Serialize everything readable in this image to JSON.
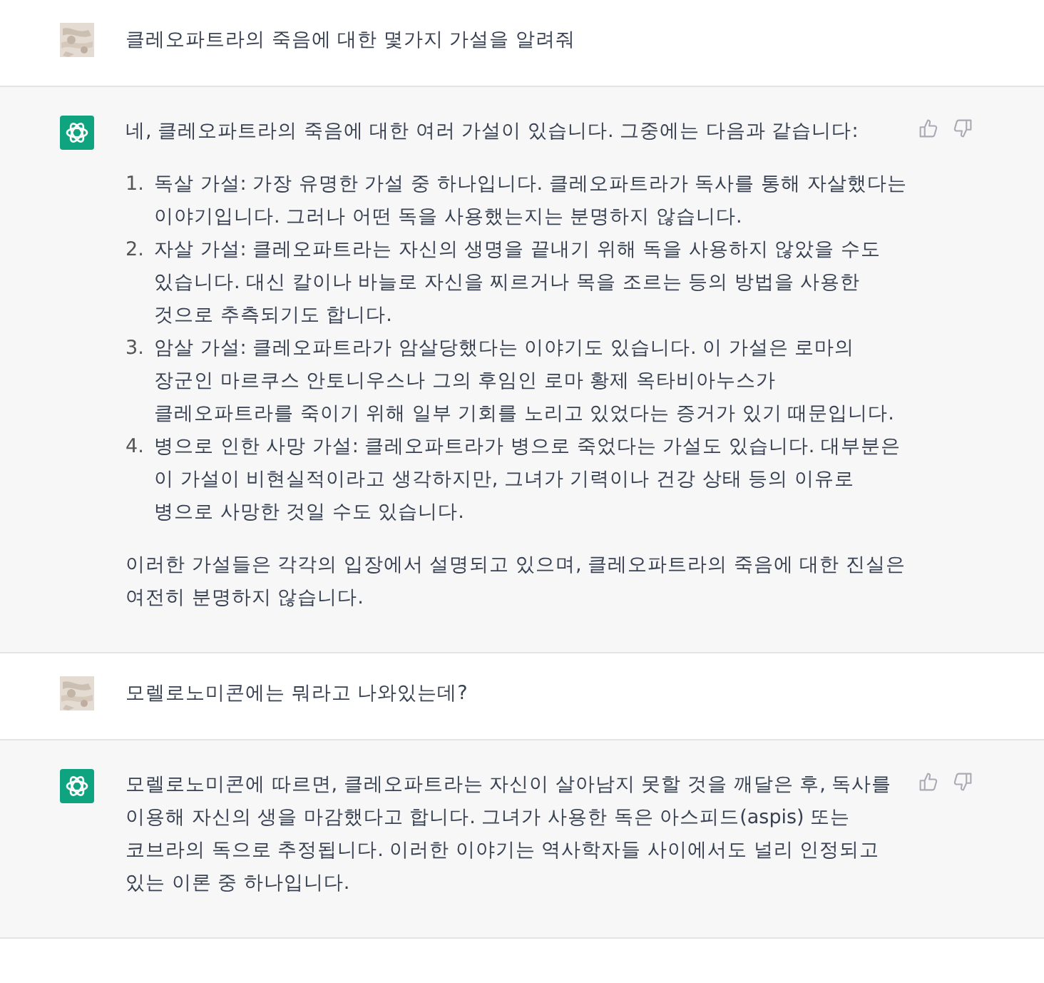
{
  "messages": [
    {
      "kind": "user",
      "text": "클레오파트라의 죽음에 대한 몇가지 가설을 알려줘"
    },
    {
      "kind": "assistant",
      "intro": "네, 클레오파트라의 죽음에 대한 여러 가설이 있습니다. 그중에는 다음과 같습니다:",
      "items": [
        {
          "number": "1.",
          "text": "독살 가설: 가장 유명한 가설 중 하나입니다. 클레오파트라가 독사를 통해 자살했다는 이야기입니다. 그러나 어떤 독을 사용했는지는 분명하지 않습니다."
        },
        {
          "number": "2.",
          "text": "자살 가설: 클레오파트라는 자신의 생명을 끝내기 위해 독을 사용하지 않았을 수도 있습니다. 대신 칼이나 바늘로 자신을 찌르거나 목을 조르는 등의 방법을 사용한 것으로 추측되기도 합니다."
        },
        {
          "number": "3.",
          "text": "암살 가설: 클레오파트라가 암살당했다는 이야기도 있습니다. 이 가설은 로마의 장군인 마르쿠스 안토니우스나 그의 후임인 로마 황제 옥타비아누스가 클레오파트라를 죽이기 위해 일부 기회를 노리고 있었다는 증거가 있기 때문입니다."
        },
        {
          "number": "4.",
          "text": "병으로 인한 사망 가설: 클레오파트라가 병으로 죽었다는 가설도 있습니다. 대부분은 이 가설이 비현실적이라고 생각하지만, 그녀가 기력이나 건강 상태 등의 이유로 병으로 사망한 것일 수도 있습니다."
        }
      ],
      "outro": "이러한 가설들은 각각의 입장에서 설명되고 있으며, 클레오파트라의 죽음에 대한 진실은 여전히 분명하지 않습니다."
    },
    {
      "kind": "user",
      "text": "모렐로노미콘에는 뭐라고 나와있는데?"
    },
    {
      "kind": "assistant",
      "intro": "모렐로노미콘에 따르면, 클레오파트라는 자신이 살아남지 못할 것을 깨달은 후, 독사를 이용해 자신의 생을 마감했다고 합니다. 그녀가 사용한 독은 아스피드(aspis) 또는 코브라의 독으로 추정됩니다. 이러한 이야기는 역사학자들 사이에서도 널리 인정되고 있는 이론 중 하나입니다."
    }
  ]
}
